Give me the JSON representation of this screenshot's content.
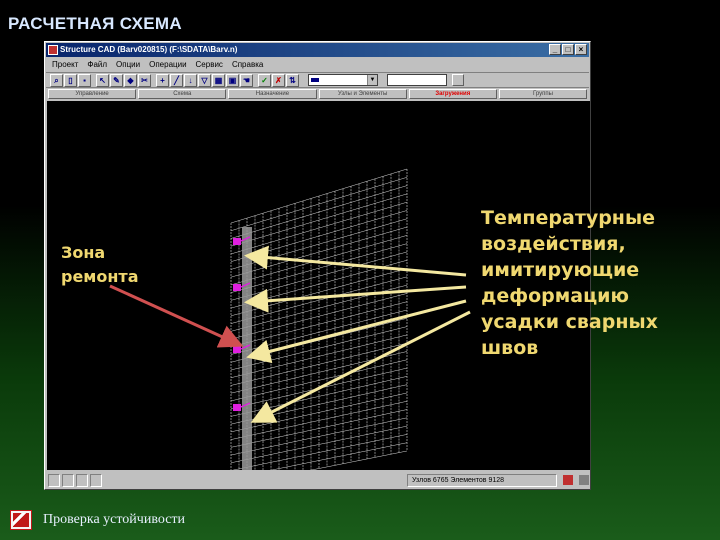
{
  "slide": {
    "title": "РАСЧЕТНАЯ СХЕМА",
    "footer_text": "Проверка устойчивости"
  },
  "app": {
    "window_title": "Structure CAD (Barv020815) (F:\\SDATA\\Barv.n)",
    "window_buttons": [
      "_",
      "□",
      "×"
    ],
    "menu": [
      "Проект",
      "Файл",
      "Опции",
      "Операции",
      "Сервис",
      "Справка"
    ],
    "tabs": [
      {
        "label": "Управление",
        "active": false
      },
      {
        "label": "Схема",
        "active": false
      },
      {
        "label": "Назначение",
        "active": false
      },
      {
        "label": "Узлы и Элементы",
        "active": false
      },
      {
        "label": "Загружения",
        "active": true
      },
      {
        "label": "Группы",
        "active": false
      }
    ],
    "status_coords": "Узлов 6765 Элементов 9128"
  },
  "annotations": {
    "zone_label": [
      "Зона",
      "ремонта"
    ],
    "effect_label": [
      "Температурные",
      "воздействия,",
      "имитирующие",
      "деформацию",
      "усадки сварных",
      "швов"
    ]
  },
  "colors": {
    "annotation_yellow": "#f0d870",
    "arrow_yellow": "#f4e8a0",
    "arrow_red": "#d05050",
    "load_marker": "#e020e0",
    "title_blue": "#d8e8ff",
    "active_tab": "#e00000"
  },
  "icons": {
    "app_icon": "scad-app-icon",
    "footer_icon": "slide-logo-icon"
  }
}
